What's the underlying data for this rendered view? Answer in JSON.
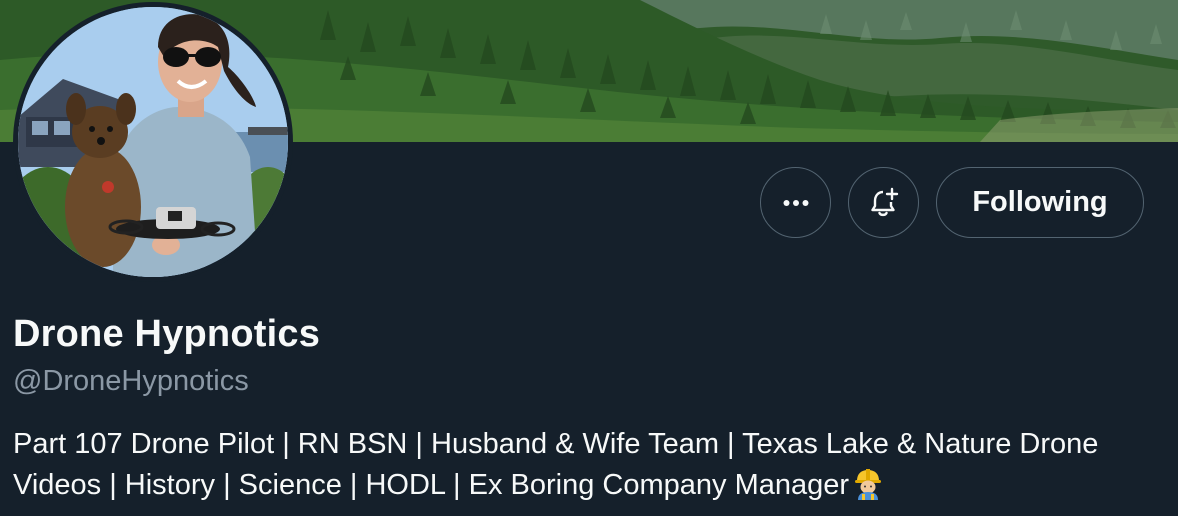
{
  "profile": {
    "display_name": "Drone Hypnotics",
    "handle": "@DroneHypnotics",
    "bio": "Part 107 Drone Pilot | RN BSN | Husband & Wife Team | Texas Lake & Nature Drone Videos | History | Science | HODL | Ex Boring Company Manager",
    "bio_emoji_icon": "construction-worker-emoji"
  },
  "actions": {
    "more_icon": "more-horizontal-icon",
    "notify_icon": "bell-plus-icon",
    "follow_label": "Following"
  },
  "images": {
    "banner": "forest-hillside-banner",
    "avatar": "woman-with-dog-and-drone-avatar"
  },
  "colors": {
    "background": "#15202b",
    "text_primary": "#f7f9f9",
    "text_secondary": "#8b98a5",
    "button_border": "#536471"
  }
}
